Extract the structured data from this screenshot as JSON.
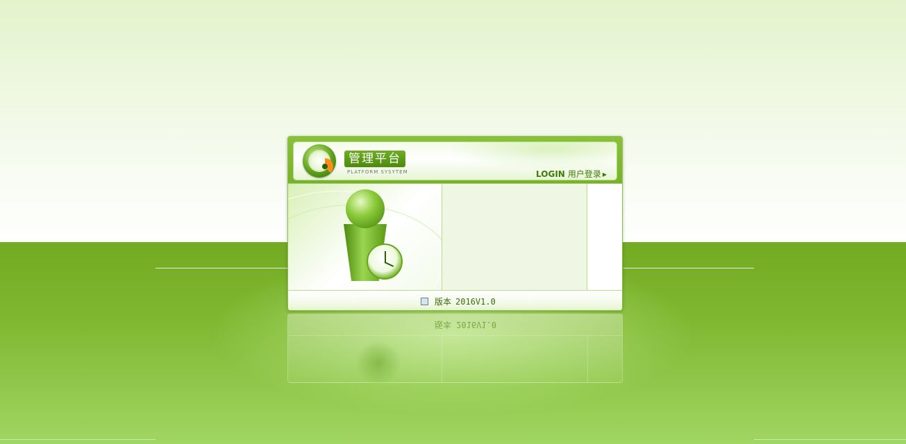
{
  "header": {
    "title": "管理平台",
    "subtitle": "PLATFORM SYSYTEM",
    "login_en": "LOGIN",
    "login_cn": "用户登录"
  },
  "footer": {
    "version_label": "版本",
    "version_value": "2016V1.0"
  },
  "reflection": {
    "version_label": "版本",
    "version_value": "2016V1.0"
  },
  "colors": {
    "brand_green": "#72aa22",
    "light_green": "#a0d663",
    "text_green": "#3a6a0c",
    "login_arrow": "#3f7a0a"
  },
  "icons": {
    "logo": "gauge-logo-icon",
    "login_arrow": "play-arrow-icon",
    "version": "document-icon",
    "illustration": "person-clock-illustration"
  }
}
